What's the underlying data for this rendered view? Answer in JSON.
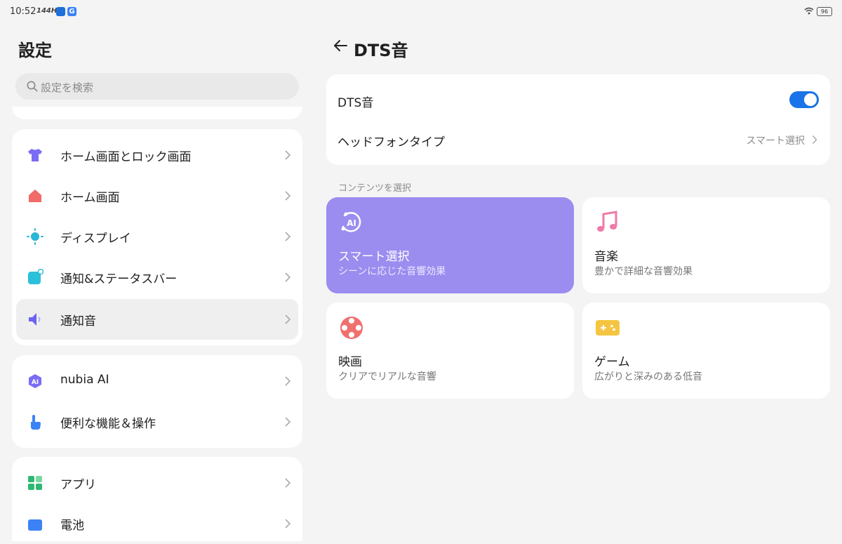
{
  "status_bar": {
    "time": "10:52",
    "refresh_rate": "144Hz",
    "app_badge": "G",
    "battery": "96"
  },
  "sidebar": {
    "title": "設定",
    "search_placeholder": "設定を検索",
    "items": [
      {
        "label": "ホーム画面とロック画面",
        "icon": "shirt-icon",
        "color": "#7b6cf6"
      },
      {
        "label": "ホーム画面",
        "icon": "home-icon",
        "color": "#f06a6a"
      },
      {
        "label": "ディスプレイ",
        "icon": "sun-icon",
        "color": "#2bb5d6"
      },
      {
        "label": "通知&ステータスバー",
        "icon": "notification-icon",
        "color": "#2bc0d9"
      },
      {
        "label": "通知音",
        "icon": "speaker-icon",
        "color": "#6c63f0",
        "active": true
      },
      {
        "label": "nubia AI",
        "icon": "ai-icon",
        "color": "#7b6cf6"
      },
      {
        "label": "便利な機能＆操作",
        "icon": "hand-pointer-icon",
        "color": "#3b82f6"
      },
      {
        "label": "アプリ",
        "icon": "apps-grid-icon",
        "color": "#2eb872"
      },
      {
        "label": "電池",
        "icon": "battery-icon",
        "color": "#3b82f6"
      }
    ]
  },
  "main": {
    "title": "DTS音",
    "dts_toggle": {
      "label": "DTS音",
      "on": true
    },
    "headphone_type": {
      "label": "ヘッドフォンタイプ",
      "value": "スマート選択"
    },
    "section_label": "コンテンツを選択",
    "tiles": [
      {
        "title": "スマート選択",
        "subtitle": "シーンに応じた音響効果",
        "icon": "ai-sparkle-icon",
        "selected": true
      },
      {
        "title": "音楽",
        "subtitle": "豊かで詳細な音響効果",
        "icon": "music-note-icon",
        "color": "#f07aa8"
      },
      {
        "title": "映画",
        "subtitle": "クリアでリアルな音響",
        "icon": "film-reel-icon",
        "color": "#f07070"
      },
      {
        "title": "ゲーム",
        "subtitle": "広がりと深みのある低音",
        "icon": "gamepad-icon",
        "color": "#f5c542"
      }
    ]
  },
  "colors": {
    "accent": "#1a73e8",
    "selected_tile": "#9b8cf0",
    "background": "#f4f4f4"
  }
}
